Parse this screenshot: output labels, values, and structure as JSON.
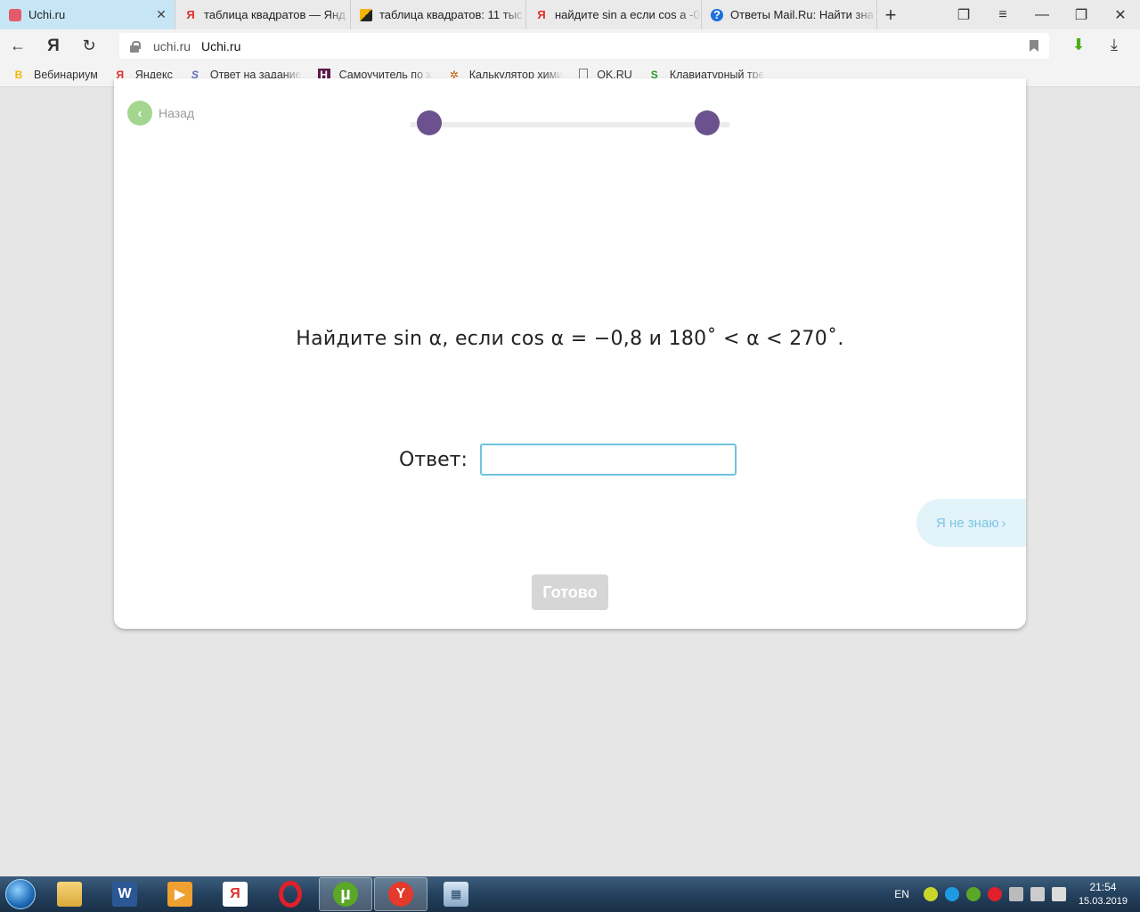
{
  "browser": {
    "tabs": [
      {
        "title": "Uchi.ru",
        "favicon": "uchi-favicon",
        "active": true
      },
      {
        "title": "таблица квадратов — Янд",
        "favicon": "yandex-favicon",
        "active": false
      },
      {
        "title": "таблица квадратов: 11 тыс",
        "favicon": "image-favicon",
        "active": false
      },
      {
        "title": "найдите sin a если cos a -0",
        "favicon": "yandex-favicon",
        "active": false
      },
      {
        "title": "Ответы Mail.Ru: Найти зна",
        "favicon": "mail-answers-favicon",
        "active": false
      }
    ],
    "new_tab_glyph": "+",
    "close_glyph": "✕",
    "address": {
      "domain": "uchi.ru",
      "page_title": "Uchi.ru"
    },
    "bookmarks": [
      {
        "label": "Вебинариум",
        "icon": "В"
      },
      {
        "label": "Яндекс",
        "icon": "Я"
      },
      {
        "label": "Ответ на задание",
        "icon": "S"
      },
      {
        "label": "Самоучитель по х",
        "icon": "H"
      },
      {
        "label": "Калькулятор хими",
        "icon": "✲"
      },
      {
        "label": "OK.RU",
        "icon": ""
      },
      {
        "label": "Клавиатурный тре",
        "icon": "S"
      }
    ]
  },
  "page": {
    "back_label": "Назад",
    "progress": {
      "steps": 2
    },
    "question": "Найдите sin α, если cos α = −0,8 и 180˚ < α < 270˚.",
    "answer_label": "Ответ:",
    "answer_value": "",
    "dont_know_label": "Я не знаю",
    "done_label": "Готово",
    "colors": {
      "accent_purple": "#6b528f",
      "input_border": "#6fc3df",
      "back_green": "#a4d68f"
    }
  },
  "taskbar": {
    "apps": [
      "explorer",
      "word",
      "media-player",
      "yandex-browser",
      "opera",
      "utorrent",
      "yandex",
      "calculator"
    ],
    "tray": {
      "language": "EN",
      "time": "21:54",
      "date": "15.03.2019"
    }
  }
}
